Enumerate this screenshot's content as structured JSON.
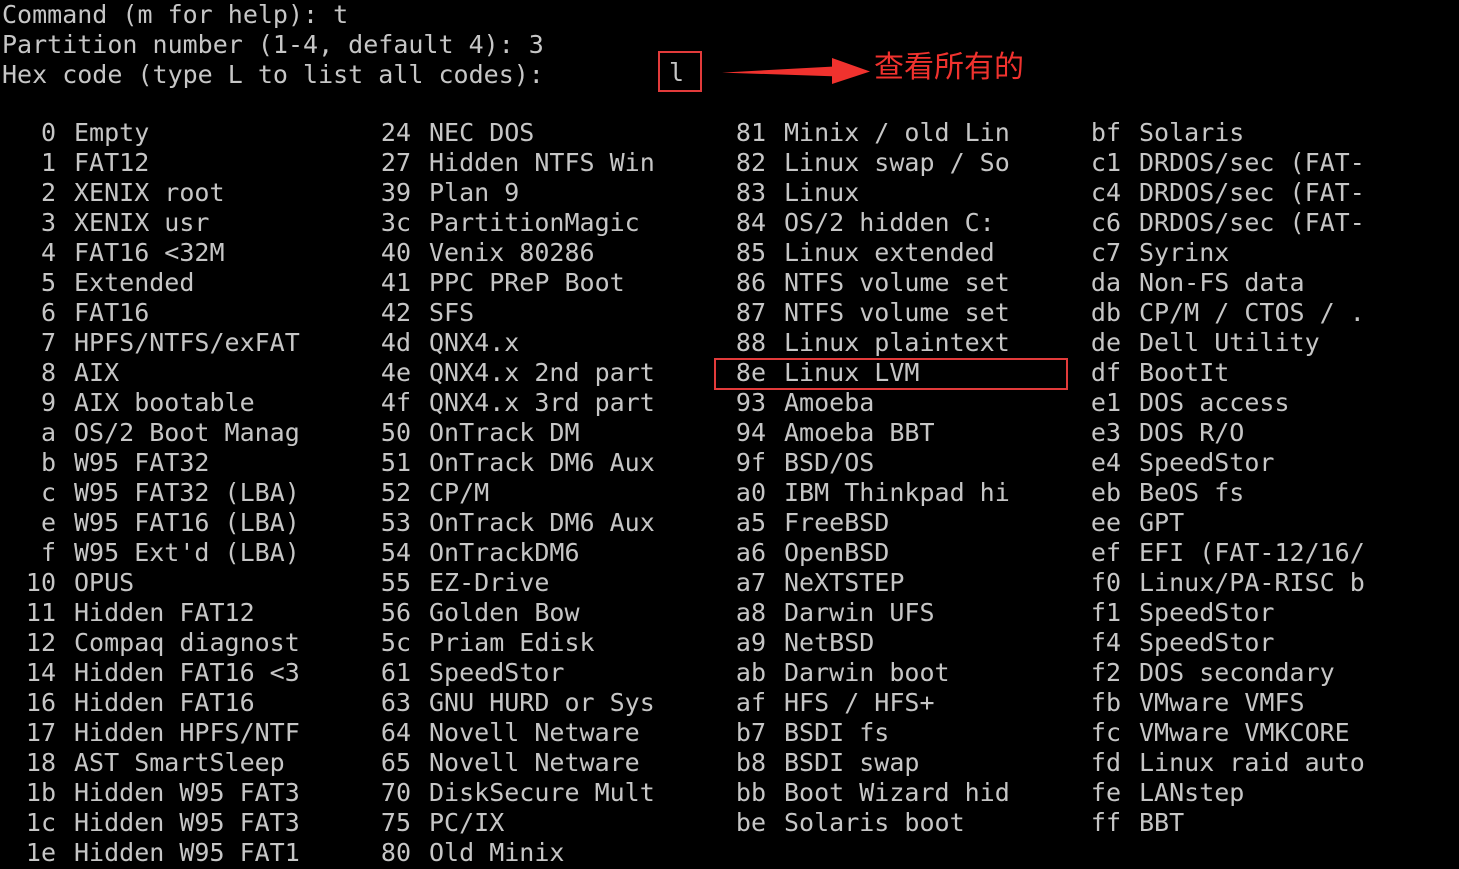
{
  "terminal": {
    "background_color": "#000000",
    "text_color": "#c6c6c6",
    "accent_color": "#e23b3b",
    "annotation_color": "#f0322e"
  },
  "prompt": {
    "line1": "Command (m for help): t",
    "line2": "Partition number (1-4, default 4): 3",
    "line3": "Hex code (type L to list all codes): ",
    "typed_value": "l"
  },
  "annotation": {
    "text": "查看所有的",
    "arrow_icon": "right-arrow-icon"
  },
  "highlight": {
    "selected_code": "8e",
    "selected_label": "Linux LVM"
  },
  "columns": [
    {
      "index": 0,
      "rows": [
        {
          "code": "0",
          "label": "Empty"
        },
        {
          "code": "1",
          "label": "FAT12"
        },
        {
          "code": "2",
          "label": "XENIX root"
        },
        {
          "code": "3",
          "label": "XENIX usr"
        },
        {
          "code": "4",
          "label": "FAT16 <32M"
        },
        {
          "code": "5",
          "label": "Extended"
        },
        {
          "code": "6",
          "label": "FAT16"
        },
        {
          "code": "7",
          "label": "HPFS/NTFS/exFAT"
        },
        {
          "code": "8",
          "label": "AIX"
        },
        {
          "code": "9",
          "label": "AIX bootable"
        },
        {
          "code": "a",
          "label": "OS/2 Boot Manag"
        },
        {
          "code": "b",
          "label": "W95 FAT32"
        },
        {
          "code": "c",
          "label": "W95 FAT32 (LBA)"
        },
        {
          "code": "e",
          "label": "W95 FAT16 (LBA)"
        },
        {
          "code": "f",
          "label": "W95 Ext'd (LBA)"
        },
        {
          "code": "10",
          "label": "OPUS"
        },
        {
          "code": "11",
          "label": "Hidden FAT12"
        },
        {
          "code": "12",
          "label": "Compaq diagnost"
        },
        {
          "code": "14",
          "label": "Hidden FAT16 <3"
        },
        {
          "code": "16",
          "label": "Hidden FAT16"
        },
        {
          "code": "17",
          "label": "Hidden HPFS/NTF"
        },
        {
          "code": "18",
          "label": "AST SmartSleep"
        },
        {
          "code": "1b",
          "label": "Hidden W95 FAT3"
        },
        {
          "code": "1c",
          "label": "Hidden W95 FAT3"
        },
        {
          "code": "1e",
          "label": "Hidden W95 FAT1"
        }
      ]
    },
    {
      "index": 1,
      "rows": [
        {
          "code": "24",
          "label": "NEC DOS"
        },
        {
          "code": "27",
          "label": "Hidden NTFS Win"
        },
        {
          "code": "39",
          "label": "Plan 9"
        },
        {
          "code": "3c",
          "label": "PartitionMagic"
        },
        {
          "code": "40",
          "label": "Venix 80286"
        },
        {
          "code": "41",
          "label": "PPC PReP Boot"
        },
        {
          "code": "42",
          "label": "SFS"
        },
        {
          "code": "4d",
          "label": "QNX4.x"
        },
        {
          "code": "4e",
          "label": "QNX4.x 2nd part"
        },
        {
          "code": "4f",
          "label": "QNX4.x 3rd part"
        },
        {
          "code": "50",
          "label": "OnTrack DM"
        },
        {
          "code": "51",
          "label": "OnTrack DM6 Aux"
        },
        {
          "code": "52",
          "label": "CP/M"
        },
        {
          "code": "53",
          "label": "OnTrack DM6 Aux"
        },
        {
          "code": "54",
          "label": "OnTrackDM6"
        },
        {
          "code": "55",
          "label": "EZ-Drive"
        },
        {
          "code": "56",
          "label": "Golden Bow"
        },
        {
          "code": "5c",
          "label": "Priam Edisk"
        },
        {
          "code": "61",
          "label": "SpeedStor"
        },
        {
          "code": "63",
          "label": "GNU HURD or Sys"
        },
        {
          "code": "64",
          "label": "Novell Netware"
        },
        {
          "code": "65",
          "label": "Novell Netware"
        },
        {
          "code": "70",
          "label": "DiskSecure Mult"
        },
        {
          "code": "75",
          "label": "PC/IX"
        },
        {
          "code": "80",
          "label": "Old Minix"
        }
      ]
    },
    {
      "index": 2,
      "rows": [
        {
          "code": "81",
          "label": "Minix / old Lin"
        },
        {
          "code": "82",
          "label": "Linux swap / So"
        },
        {
          "code": "83",
          "label": "Linux"
        },
        {
          "code": "84",
          "label": "OS/2 hidden C:"
        },
        {
          "code": "85",
          "label": "Linux extended"
        },
        {
          "code": "86",
          "label": "NTFS volume set"
        },
        {
          "code": "87",
          "label": "NTFS volume set"
        },
        {
          "code": "88",
          "label": "Linux plaintext"
        },
        {
          "code": "8e",
          "label": "Linux LVM"
        },
        {
          "code": "93",
          "label": "Amoeba"
        },
        {
          "code": "94",
          "label": "Amoeba BBT"
        },
        {
          "code": "9f",
          "label": "BSD/OS"
        },
        {
          "code": "a0",
          "label": "IBM Thinkpad hi"
        },
        {
          "code": "a5",
          "label": "FreeBSD"
        },
        {
          "code": "a6",
          "label": "OpenBSD"
        },
        {
          "code": "a7",
          "label": "NeXTSTEP"
        },
        {
          "code": "a8",
          "label": "Darwin UFS"
        },
        {
          "code": "a9",
          "label": "NetBSD"
        },
        {
          "code": "ab",
          "label": "Darwin boot"
        },
        {
          "code": "af",
          "label": "HFS / HFS+"
        },
        {
          "code": "b7",
          "label": "BSDI fs"
        },
        {
          "code": "b8",
          "label": "BSDI swap"
        },
        {
          "code": "bb",
          "label": "Boot Wizard hid"
        },
        {
          "code": "be",
          "label": "Solaris boot"
        }
      ]
    },
    {
      "index": 3,
      "rows": [
        {
          "code": "bf",
          "label": "Solaris"
        },
        {
          "code": "c1",
          "label": "DRDOS/sec (FAT-"
        },
        {
          "code": "c4",
          "label": "DRDOS/sec (FAT-"
        },
        {
          "code": "c6",
          "label": "DRDOS/sec (FAT-"
        },
        {
          "code": "c7",
          "label": "Syrinx"
        },
        {
          "code": "da",
          "label": "Non-FS data"
        },
        {
          "code": "db",
          "label": "CP/M / CTOS / ."
        },
        {
          "code": "de",
          "label": "Dell Utility"
        },
        {
          "code": "df",
          "label": "BootIt"
        },
        {
          "code": "e1",
          "label": "DOS access"
        },
        {
          "code": "e3",
          "label": "DOS R/O"
        },
        {
          "code": "e4",
          "label": "SpeedStor"
        },
        {
          "code": "eb",
          "label": "BeOS fs"
        },
        {
          "code": "ee",
          "label": "GPT"
        },
        {
          "code": "ef",
          "label": "EFI (FAT-12/16/"
        },
        {
          "code": "f0",
          "label": "Linux/PA-RISC b"
        },
        {
          "code": "f1",
          "label": "SpeedStor"
        },
        {
          "code": "f4",
          "label": "SpeedStor"
        },
        {
          "code": "f2",
          "label": "DOS secondary"
        },
        {
          "code": "fb",
          "label": "VMware VMFS"
        },
        {
          "code": "fc",
          "label": "VMware VMKCORE"
        },
        {
          "code": "fd",
          "label": "Linux raid auto"
        },
        {
          "code": "fe",
          "label": "LANstep"
        },
        {
          "code": "ff",
          "label": "BBT"
        }
      ]
    }
  ]
}
